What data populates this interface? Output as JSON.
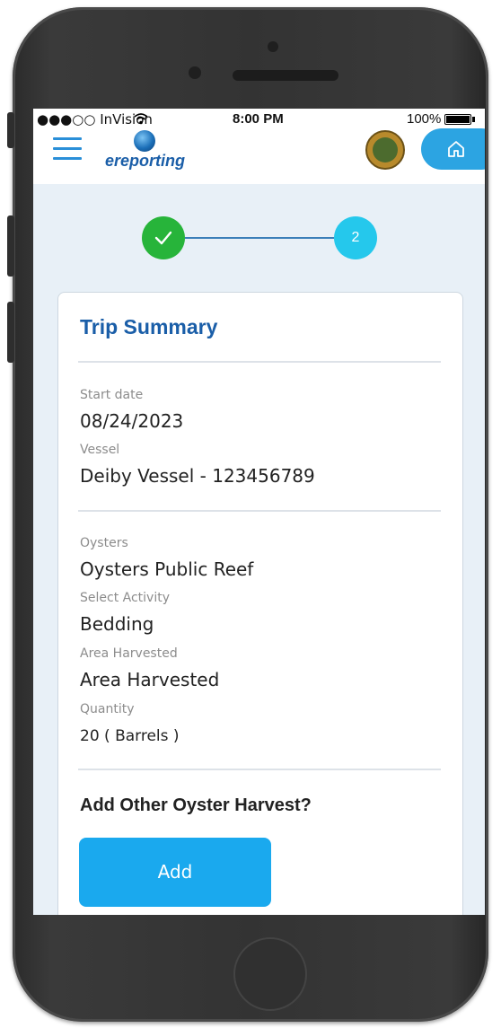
{
  "statusbar": {
    "carrier": "●●●○○ InVision",
    "time": "8:00 PM",
    "battery": "100%"
  },
  "header": {
    "logo_text": "ereporting",
    "menu_icon": "hamburger-icon",
    "home_icon": "home-icon",
    "accent_color": "#2ca4e2",
    "brand_color": "#1a5ea8"
  },
  "stepper": {
    "step1_state": "complete",
    "step1_icon": "checkmark-icon",
    "step2_label": "2",
    "complete_color": "#27b43a",
    "active_color": "#25c8ec"
  },
  "summary": {
    "title": "Trip Summary",
    "fields": [
      {
        "label": "Start date",
        "value": "08/24/2023"
      },
      {
        "label": "Vessel",
        "value": "Deiby Vessel - 123456789"
      },
      {
        "label": "Oysters",
        "value": "Oysters Public Reef"
      },
      {
        "label": "Select Activity",
        "value": "Bedding"
      },
      {
        "label": "Area Harvested",
        "value": "Area Harvested"
      },
      {
        "label": "Quantity",
        "value": "20 ( Barrels )"
      }
    ],
    "question": "Add Other Oyster Harvest?",
    "add_label": "Add"
  }
}
